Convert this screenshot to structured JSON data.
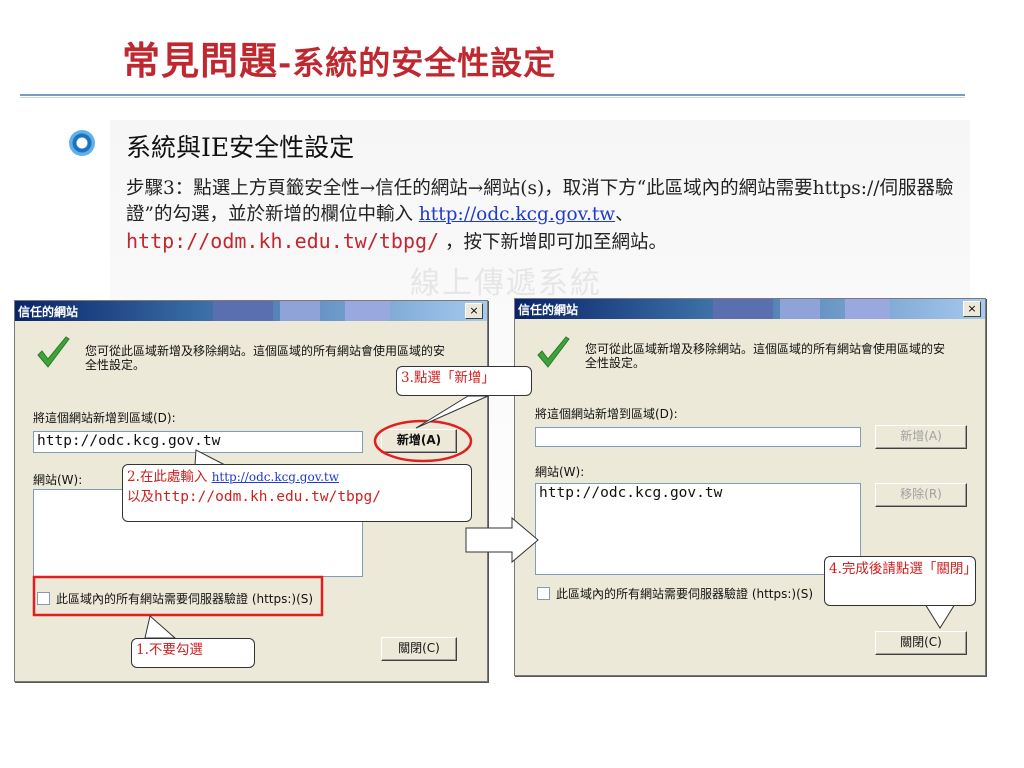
{
  "slide": {
    "title_main": "常見問題",
    "title_sub": "-系統的安全性設定",
    "watermark": "線上傳遞系統",
    "heading": "系統與IE安全性設定",
    "step_prefix": "步驟3：點選上方頁籤安全性→信任的網站→網站(s)，取消下方“此區域內的網站需要https://伺服器驗證”的勾選，並於新增的欄位中輸入",
    "url1": "http://odc.kcg.gov.tw",
    "sep": "、",
    "url2": "http://odm.kh.edu.tw/tbpg/",
    "step_suffix": "，按下新增即可加至網站。"
  },
  "dialog_left": {
    "title": "信任的網站",
    "close_symbol": "×",
    "message": "您可從此區域新增及移除網站。這個區域的所有網站會使用區域的安全性設定。",
    "add_label": "將這個網站新增到區域(D):",
    "input_value": "http://odc.kcg.gov.tw",
    "add_button": "新增(A)",
    "sites_label": "網站(W):",
    "require_https": "此區域內的所有網站需要伺服器驗證 (https:)(S)",
    "close_button": "關閉(C)"
  },
  "dialog_right": {
    "title": "信任的網站",
    "close_symbol": "×",
    "message": "您可從此區域新增及移除網站。這個區域的所有網站會使用區域的安全性設定。",
    "add_label": "將這個網站新增到區域(D):",
    "input_value": "",
    "add_button": "新增(A)",
    "sites_label": "網站(W):",
    "site_entry": "http://odc.kcg.gov.tw",
    "remove_button": "移除(R)",
    "require_https": "此區域內的所有網站需要伺服器驗證 (https:)(S)",
    "close_button": "關閉(C)"
  },
  "callouts": {
    "c1": "1.不要勾選",
    "c2_prefix": "2.在此處輸入",
    "c2_url": "http://odc.kcg.gov.tw",
    "c2_line2_prefix": "以及",
    "c2_line2_url": "http://odm.kh.edu.tw/tbpg/",
    "c3": "3.點選「新增」",
    "c4": "4.完成後請點選「關閉」"
  },
  "colors": {
    "title_red": "#c0282f",
    "callout_red": "#d02020",
    "link_blue": "#1f3ad0",
    "rule_blue": "#7a9cc0",
    "dialog_bg": "#ece9d8",
    "highlight_red": "#e02020"
  }
}
